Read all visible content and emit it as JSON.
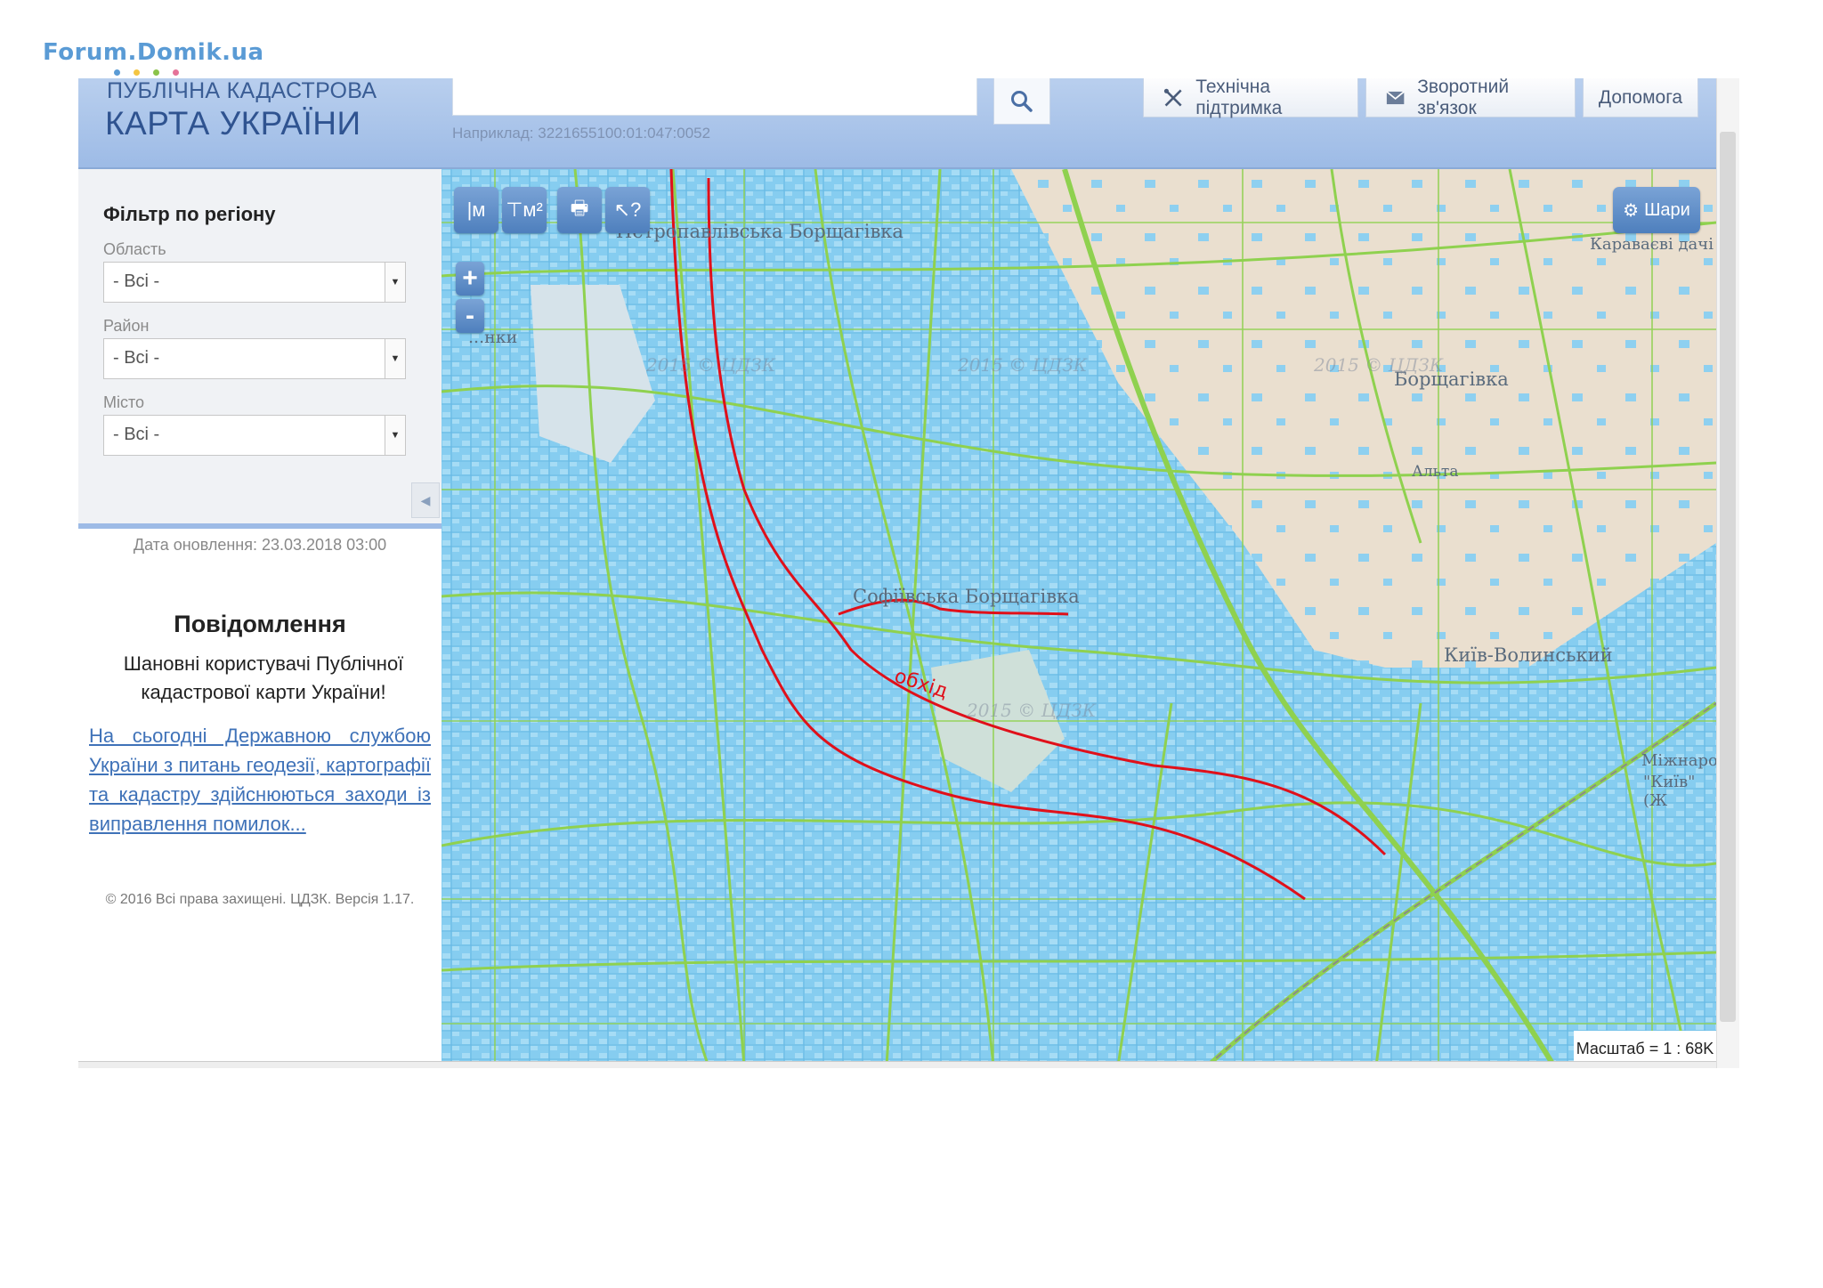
{
  "watermark": {
    "text": "Forum.Domik.ua",
    "color": "#5a9bd5"
  },
  "header": {
    "logo_line1": "ПУБЛІЧНА КАДАСТРОВА",
    "logo_line2": "КАРТА УКРАЇНИ",
    "search_value": "",
    "search_hint": "Наприклад: 3221655100:01:047:0052",
    "buttons": [
      {
        "label": "Технічна підтримка",
        "icon": "tools-icon"
      },
      {
        "label": "Зворотний зв'язок",
        "icon": "envelope-icon"
      },
      {
        "label": "Допомога"
      }
    ]
  },
  "filter": {
    "title": "Фільтр по регіону",
    "oblast_label": "Область",
    "oblast_value": "- Всі -",
    "raion_label": "Район",
    "raion_value": "- Всі -",
    "misto_label": "Місто",
    "misto_value": "- Всі -"
  },
  "update_date": "Дата оновлення: 23.03.2018 03:00",
  "notice": {
    "title": "Повідомлення",
    "text": "Шановні користувачі Публічної кадастрової карти України!",
    "link": "На сьогодні Державною службою України з питань геодезії, картографії та кадастру здійснюються заходи із виправлення помилок..."
  },
  "copyright": "© 2016 Всі права захищені. ЦДЗК. Версія 1.17.",
  "map": {
    "tools": [
      {
        "icon": "measure-distance-icon",
        "glyph": "|м"
      },
      {
        "icon": "measure-area-icon",
        "glyph": "⊤м²"
      },
      {
        "icon": "print-icon",
        "glyph": "🖶"
      },
      {
        "icon": "identify-icon",
        "glyph": "↖?"
      }
    ],
    "zoom_in": "+",
    "zoom_out": "-",
    "layers_label": "Шари",
    "scale": "Масштаб = 1 : 68K",
    "places": [
      {
        "name": "Петропавлівська Борщагівка"
      },
      {
        "name": "Борщагівка"
      },
      {
        "name": "Софіївська Борщагівка"
      },
      {
        "name": "Київ-Волинський"
      },
      {
        "name": "Альта"
      },
      {
        "name": "Міжнародн"
      },
      {
        "name": "\"Київ\" (Ж"
      },
      {
        "name": "Караваєві дачі"
      },
      {
        "name": "...нки"
      }
    ],
    "annotation": "обхід",
    "colors": {
      "parcel": "#7fc8ee",
      "boundary": "#8fd14f",
      "land": "#eadfcf",
      "annotation": "#e0101a"
    }
  }
}
